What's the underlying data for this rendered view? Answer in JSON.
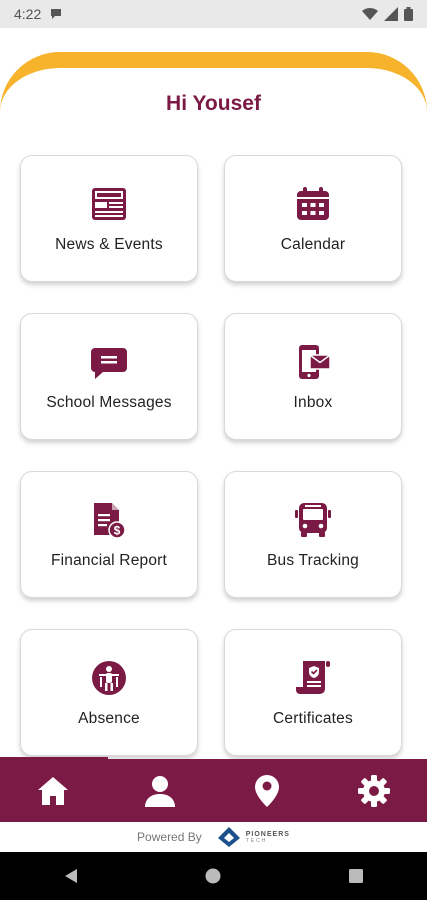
{
  "status_bar": {
    "time": "4:22",
    "icons": [
      "chat-bubble-icon",
      "wifi-icon",
      "signal-icon",
      "battery-icon"
    ]
  },
  "greeting": "Hi Yousef",
  "tiles": [
    {
      "label": "News & Events",
      "icon": "news-icon"
    },
    {
      "label": "Calendar",
      "icon": "calendar-icon"
    },
    {
      "label": "School Messages",
      "icon": "chat-bubble-icon"
    },
    {
      "label": "Inbox",
      "icon": "mobile-mail-icon"
    },
    {
      "label": "Financial Report",
      "icon": "financial-report-icon"
    },
    {
      "label": "Bus Tracking",
      "icon": "bus-icon"
    },
    {
      "label": "Absence",
      "icon": "absence-icon"
    },
    {
      "label": "Certificates",
      "icon": "certificate-icon"
    }
  ],
  "bottom_nav": {
    "items": [
      "home-icon",
      "profile-icon",
      "location-icon",
      "settings-icon"
    ],
    "active": "home"
  },
  "footer": {
    "powered_by": "Powered By",
    "brand_name": "PIONEERS",
    "brand_sub": "TECH"
  },
  "colors": {
    "brand": "#7b1b45",
    "accent": "#f6b32b"
  }
}
